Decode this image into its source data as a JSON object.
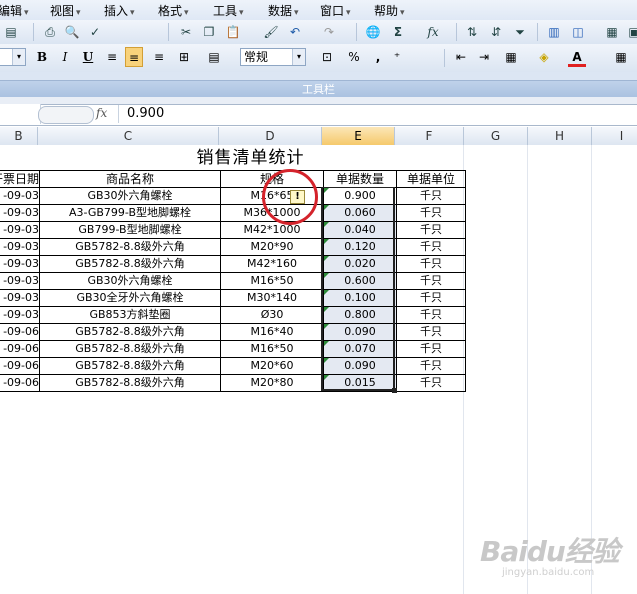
{
  "menubar": {
    "items": [
      {
        "label": "编辑"
      },
      {
        "label": "视图"
      },
      {
        "label": "插入"
      },
      {
        "label": "格式"
      },
      {
        "label": "工具"
      },
      {
        "label": "数据"
      },
      {
        "label": "窗口"
      },
      {
        "label": "帮助"
      }
    ]
  },
  "toolbar": {
    "caption": "工具栏",
    "font_style": "常规",
    "percent": "%",
    "comma": ",",
    "bold": "B",
    "italic": "I",
    "underline": "U",
    "sigma": "Σ",
    "fx": "fx"
  },
  "formula_bar": {
    "fx_label": "fx",
    "value": "0.900"
  },
  "columns": [
    "B",
    "C",
    "D",
    "E",
    "F",
    "G",
    "H",
    "I"
  ],
  "selected_column": "E",
  "sheet": {
    "title": "销售清单统计",
    "headers": [
      "开票日期",
      "商品名称",
      "规格",
      "单据数量",
      "单据单位"
    ],
    "rows": [
      {
        "date": "-09-03",
        "name": "GB30外六角螺栓",
        "spec": "M16*65",
        "qty": "0.900",
        "unit": "千只"
      },
      {
        "date": "-09-03",
        "name": "A3-GB799-B型地脚螺栓",
        "spec": "M36*1000",
        "qty": "0.060",
        "unit": "千只"
      },
      {
        "date": "-09-03",
        "name": "GB799-B型地脚螺栓",
        "spec": "M42*1000",
        "qty": "0.040",
        "unit": "千只"
      },
      {
        "date": "-09-03",
        "name": "GB5782-8.8级外六角",
        "spec": "M20*90",
        "qty": "0.120",
        "unit": "千只"
      },
      {
        "date": "-09-03",
        "name": "GB5782-8.8级外六角",
        "spec": "M42*160",
        "qty": "0.020",
        "unit": "千只"
      },
      {
        "date": "-09-03",
        "name": "GB30外六角螺栓",
        "spec": "M16*50",
        "qty": "0.600",
        "unit": "千只"
      },
      {
        "date": "-09-03",
        "name": "GB30全牙外六角螺栓",
        "spec": "M30*140",
        "qty": "0.100",
        "unit": "千只"
      },
      {
        "date": "-09-03",
        "name": "GB853方斜垫圈",
        "spec": "Ø30",
        "qty": "0.800",
        "unit": "千只"
      },
      {
        "date": "-09-06",
        "name": "GB5782-8.8级外六角",
        "spec": "M16*40",
        "qty": "0.090",
        "unit": "千只"
      },
      {
        "date": "-09-06",
        "name": "GB5782-8.8级外六角",
        "spec": "M16*50",
        "qty": "0.070",
        "unit": "千只"
      },
      {
        "date": "-09-06",
        "name": "GB5782-8.8级外六角",
        "spec": "M20*60",
        "qty": "0.090",
        "unit": "千只"
      },
      {
        "date": "-09-06",
        "name": "GB5782-8.8级外六角",
        "spec": "M20*80",
        "qty": "0.015",
        "unit": "千只"
      }
    ]
  },
  "watermark": {
    "main": "Baidu经验",
    "sub": "jingyan.baidu.com"
  },
  "colors": {
    "annotation_circle": "#d4232b",
    "selected_column": "#f5c96c",
    "selection_fill": "#e4e9f2",
    "number_stored_as_text_marker": "#2e8b3a"
  }
}
